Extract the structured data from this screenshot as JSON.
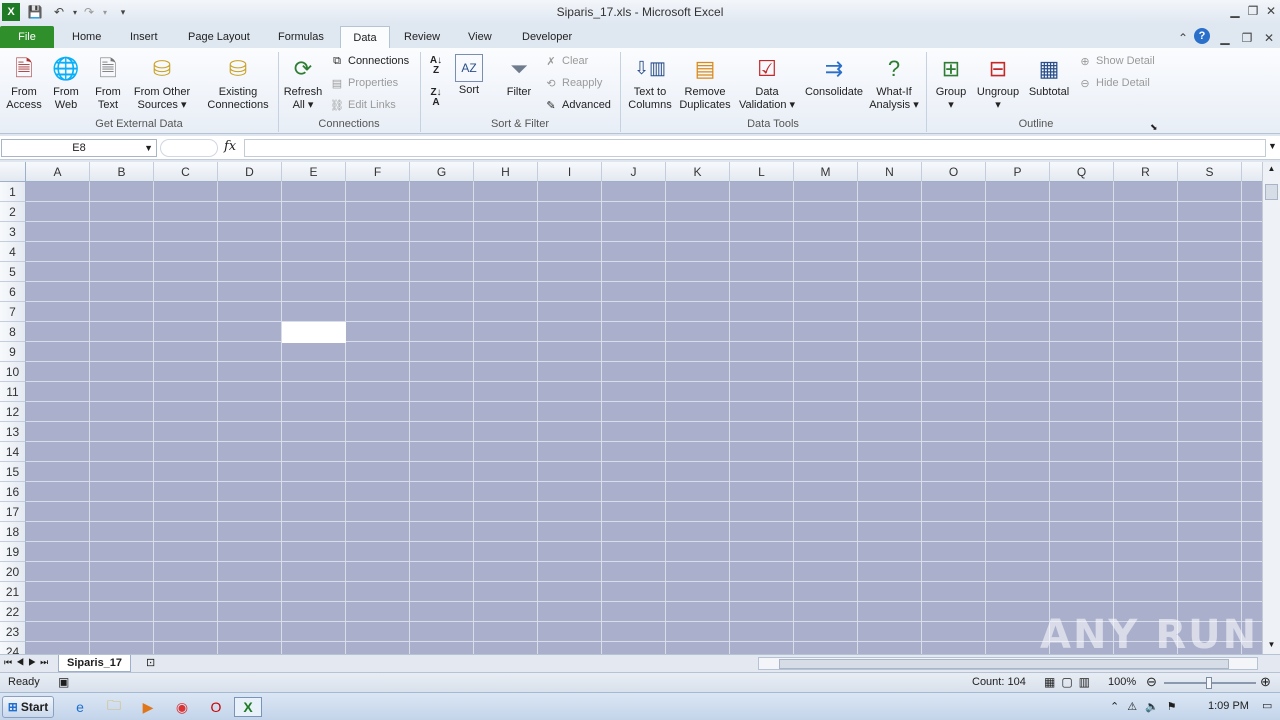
{
  "window": {
    "title": "Siparis_17.xls - Microsoft Excel"
  },
  "tabs": [
    "File",
    "Home",
    "Insert",
    "Page Layout",
    "Formulas",
    "Data",
    "Review",
    "View",
    "Developer"
  ],
  "ribbon": {
    "get_external": {
      "from_access": "From\nAccess",
      "from_web": "From\nWeb",
      "from_text": "From\nText",
      "from_other": "From Other\nSources ▾",
      "existing": "Existing\nConnections",
      "group_label": "Get External Data"
    },
    "connections": {
      "refresh": "Refresh\nAll ▾",
      "connections": "Connections",
      "properties": "Properties",
      "edit_links": "Edit Links",
      "group_label": "Connections"
    },
    "sort_filter": {
      "sort": "Sort",
      "filter": "Filter",
      "clear": "Clear",
      "reapply": "Reapply",
      "advanced": "Advanced",
      "group_label": "Sort & Filter"
    },
    "data_tools": {
      "text_to_columns": "Text to\nColumns",
      "remove_duplicates": "Remove\nDuplicates",
      "data_validation": "Data\nValidation ▾",
      "consolidate": "Consolidate",
      "what_if": "What-If\nAnalysis ▾",
      "group_label": "Data Tools"
    },
    "outline": {
      "group": "Group\n▾",
      "ungroup": "Ungroup\n▾",
      "subtotal": "Subtotal",
      "show_detail": "Show Detail",
      "hide_detail": "Hide Detail",
      "group_label": "Outline"
    }
  },
  "formula_bar": {
    "name_box": "E8",
    "fx": "fx",
    "value": ""
  },
  "grid": {
    "columns": [
      "A",
      "B",
      "C",
      "D",
      "E",
      "F",
      "G",
      "H",
      "I",
      "J",
      "K",
      "L",
      "M",
      "N",
      "O",
      "P",
      "Q",
      "R",
      "S"
    ],
    "rows": [
      "1",
      "2",
      "3",
      "4",
      "5",
      "6",
      "7",
      "8",
      "9",
      "10",
      "11",
      "12",
      "13",
      "14",
      "15",
      "16",
      "17",
      "18",
      "19",
      "20",
      "21",
      "22",
      "23",
      "24"
    ]
  },
  "sheet_tabs": [
    "Siparis_17"
  ],
  "status": {
    "ready": "Ready",
    "count": "Count: 104",
    "zoom": "100%"
  },
  "taskbar": {
    "start": "Start",
    "clock": "1:09 PM"
  },
  "watermark": "ANY RUN"
}
